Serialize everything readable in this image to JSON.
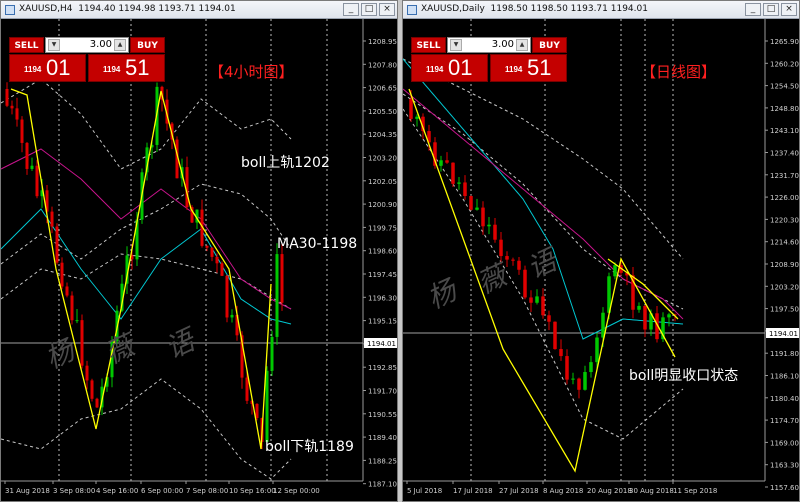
{
  "windows": [
    {
      "id": "left",
      "title": "XAUUSD,H4",
      "ohlc": "1194.40 1194.98 1193.71 1194.01",
      "trade": {
        "sell": "SELL",
        "buy": "BUY",
        "qty": "3.00",
        "bid_small": "1194",
        "bid_big": "01",
        "ask_small": "1194",
        "ask_big": "51"
      },
      "price_axis": [
        "1208.95",
        "1207.80",
        "1206.65",
        "1205.50",
        "1204.35",
        "1203.20",
        "1202.05",
        "1200.90",
        "1199.75",
        "1198.60",
        "1197.45",
        "1196.30",
        "1195.15",
        "1194.01",
        "1192.85",
        "1191.70",
        "1190.55",
        "1189.40",
        "1188.25",
        "1187.10"
      ],
      "current_price": "1194.01",
      "date_axis": [
        "31 Aug 2018",
        "3 Sep 08:00",
        "4 Sep 16:00",
        "6 Sep 00:00",
        "7 Sep 08:00",
        "10 Sep 16:00",
        "12 Sep 00:00"
      ],
      "annotations": [
        "【4小时图】",
        "boll上轨1202",
        "MA30-1198",
        "boll下轨1189"
      ],
      "watermark": [
        "杨",
        "薇",
        "语"
      ]
    },
    {
      "id": "right",
      "title": "XAUUSD,Daily",
      "ohlc": "1198.50 1198.50 1193.71 1194.01",
      "trade": {
        "sell": "SELL",
        "buy": "BUY",
        "qty": "3.00",
        "bid_small": "1194",
        "bid_big": "01",
        "ask_small": "1194",
        "ask_big": "51"
      },
      "price_axis": [
        "1265.90",
        "1260.20",
        "1254.50",
        "1248.80",
        "1243.10",
        "1237.40",
        "1231.70",
        "1226.00",
        "1220.30",
        "1214.60",
        "1208.90",
        "1203.20",
        "1197.50",
        "1194.01",
        "1191.80",
        "1186.10",
        "1180.40",
        "1174.70",
        "1169.00",
        "1163.30",
        "1157.60"
      ],
      "current_price": "1194.01",
      "date_axis": [
        "5 Jul 2018",
        "17 Jul 2018",
        "27 Jul 2018",
        "8 Aug 2018",
        "20 Aug 2018",
        "30 Aug 2018",
        "11 Sep 2018"
      ],
      "annotations": [
        "【日线图】",
        "boll明显收口状态"
      ],
      "watermark": [
        "杨",
        "薇",
        "语"
      ]
    }
  ],
  "window_buttons": {
    "minimize": "_",
    "maximize": "□",
    "close": "×"
  },
  "colors": {
    "bull": "#00c800",
    "bear": "#e00000",
    "trend": "#ffff00",
    "bands": "#c8c8c8",
    "ma_cyan": "#00c8d2",
    "ma_magenta": "#c8148c",
    "annot_red": "#ff2020",
    "annot_white": "#ffffff",
    "grid": "#bbbbbb"
  }
}
